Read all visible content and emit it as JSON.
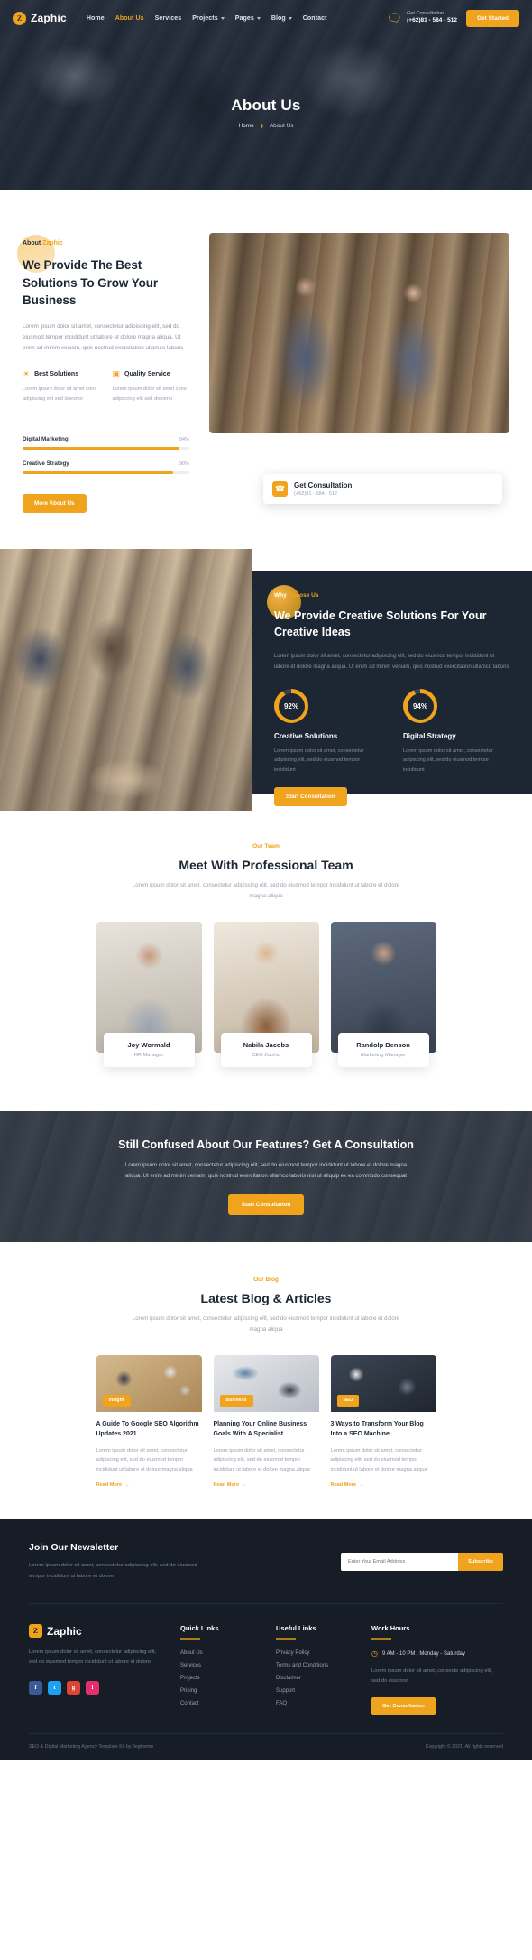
{
  "header": {
    "brand": "Zaphic",
    "brand_mark": "Z",
    "nav": [
      {
        "label": "Home",
        "caret": false,
        "active": false
      },
      {
        "label": "About Us",
        "caret": false,
        "active": true
      },
      {
        "label": "Services",
        "caret": false,
        "active": false
      },
      {
        "label": "Projects",
        "caret": true,
        "active": false
      },
      {
        "label": "Pages",
        "caret": true,
        "active": false
      },
      {
        "label": "Blog",
        "caret": true,
        "active": false
      },
      {
        "label": "Contact",
        "caret": false,
        "active": false
      }
    ],
    "chat_icon": "chat-icon",
    "consult_label": "Get Consultation",
    "consult_phone": "(+62)81 - 584 - 512",
    "cta_label": "Get Started"
  },
  "hero": {
    "title": "About Us",
    "crumb_home": "Home",
    "crumb_sep": "❯",
    "crumb_current": "About Us"
  },
  "about": {
    "eyebrow_plain": "About ",
    "eyebrow_hl": "Zaphic",
    "heading": "We Provide The Best Solutions To Grow Your Business",
    "paragraph": "Lorem ipsum dolor sit amet, consectetur adipiscing elit, sed do eiusmod tempor incididunt ut labore et dolore magna aliqua. Ut enim ad minim veniam, quis nostrud exercitation ullamco laboris",
    "features": [
      {
        "icon": "lightbulb-icon",
        "glyph": "☀",
        "title": "Best Solutions",
        "text": "Lorem ipsum dolor sit amet cons adipiscing elit sed doesmo"
      },
      {
        "icon": "monitor-icon",
        "glyph": "▣",
        "title": "Quality Service",
        "text": "Lorem ipsum dolor sit amet cons adipiscing elit sed doesmo"
      }
    ],
    "skills": [
      {
        "name": "Digital Marketing",
        "percent": "94%",
        "value": 94
      },
      {
        "name": "Creative Strategy",
        "percent": "90%",
        "value": 90
      }
    ],
    "button": "More About Us",
    "card_icon": "phone-icon",
    "card_title": "Get Consultation",
    "card_sub": "(+62)81 - 584 - 512"
  },
  "why": {
    "eyebrow_plain": "Why ",
    "eyebrow_hl": "Choose Us",
    "heading": "We Provide Creative Solutions For Your Creative Ideas",
    "paragraph": "Lorem ipsum dolor sit amet, consectetur adipiscing elit, sed do eiusmod tempor incididunt ut labore et dolore magna aliqua. Ut enim ad minim veniam, quis nostrud exercitation ullamco laboris",
    "stats": [
      {
        "percent": "92%",
        "title": "Creative Solutions",
        "text": "Lorem ipsum dolor sit amet, consectetur adipiscing elit, sed do eiusmod tempor incididunt"
      },
      {
        "percent": "94%",
        "title": "Digital Strategy",
        "text": "Lorem ipsum dolor sit amet, consectetur adipiscing elit, sed do eiusmod tempor incididunt"
      }
    ],
    "button": "Start Consultation"
  },
  "team": {
    "eyebrow": "Our Team",
    "heading": "Meet With Professional Team",
    "paragraph": "Lorem ipsum dolor sit amet, consectetur adipiscing elit, sed do eiusmod tempor incididunt ut labore et dolore magna aliqua",
    "members": [
      {
        "name": "Joy Wormald",
        "role": "HR Manager"
      },
      {
        "name": "Nabila Jacobs",
        "role": "CEO Zaphic"
      },
      {
        "name": "Randolp Benson",
        "role": "Marketing Manager"
      }
    ]
  },
  "cta": {
    "heading": "Still Confused About Our Features? Get A Consultation",
    "paragraph": "Lorem ipsum dolor sit amet, consectetur adipiscing elit, sed do eiusmod tempor incididunt ut labore et dolore magna aliqua. Ut enim ad minim veniam, quis nostrud exercitation ullamco laboris nisi ut aliquip ex ea commodo consequat",
    "button": "Start Consultation"
  },
  "blog": {
    "eyebrow": "Our Blog",
    "heading": "Latest Blog & Articles",
    "paragraph": "Lorem ipsum dolor sit amet, consectetur adipiscing elit, sed do eiusmod tempor incididunt ut labore et dolore magna aliqua",
    "posts": [
      {
        "badge": "Insight",
        "title": "A Guide To Google SEO Algorithm Updates 2021",
        "text": "Lorem ipsum dolor sit amet, consectetur adipiscing elit, sed do eiusmod tempor incididunt ut labore et dolore magna aliqua",
        "more": "Read More"
      },
      {
        "badge": "Business",
        "title": "Planning Your Online Business Goals With A Specialist",
        "text": "Lorem ipsum dolor sit amet, consectetur adipiscing elit, sed do eiusmod tempor incididunt ut labore et dolore magna aliqua",
        "more": "Read More"
      },
      {
        "badge": "SEO",
        "title": "3 Ways to Transform Your Blog Into a SEO Machine",
        "text": "Lorem ipsum dolor sit amet, consectetur adipiscing elit, sed do eiusmod tempor incididunt ut labore et dolore magna aliqua",
        "more": "Read More"
      }
    ],
    "more_arrow": "→"
  },
  "footer": {
    "newsletter_heading": "Join Our Newsletter",
    "newsletter_text": "Lorem ipsum dolor sit amet, consectetur adipiscing elit, sed do eiusmod tempor incididunt ut labore et dolore",
    "email_placeholder": "Enter Your Email Address",
    "subscribe": "Subscribe",
    "brand": "Zaphic",
    "brand_mark": "Z",
    "brand_text": "Lorem ipsum dolor sit amet, consectetur adipiscing elit, sed do eiusmod tempor incididunt ut labore et dolore",
    "socials": [
      {
        "name": "facebook-icon",
        "glyph": "f",
        "color": "#3b5998"
      },
      {
        "name": "twitter-icon",
        "glyph": "t",
        "color": "#1da1f2"
      },
      {
        "name": "google-icon",
        "glyph": "g",
        "color": "#db4437"
      },
      {
        "name": "instagram-icon",
        "glyph": "i",
        "color": "#e1306c"
      }
    ],
    "quick_links_heading": "Quick Links",
    "quick_links": [
      "About Us",
      "Services",
      "Projects",
      "Pricing",
      "Contact"
    ],
    "useful_links_heading": "Useful Links",
    "useful_links": [
      "Privacy Policy",
      "Terms and Conditions",
      "Disclaimer",
      "Support",
      "FAQ"
    ],
    "work_hours_heading": "Work Hours",
    "work_hours_icon": "clock-icon",
    "work_hours_value": "9 AM - 10 PM , Monday - Saturday",
    "work_hours_text": "Lorem ipsum dolor sit amet, consecte adipiscing elit, sed do eiusmod",
    "work_hours_button": "Get Consultation",
    "bottom_left": "SEO & Digital Marketing Agency Template Kit by Jegtheme",
    "bottom_right": "Copyright © 2021. All rights reserved"
  }
}
